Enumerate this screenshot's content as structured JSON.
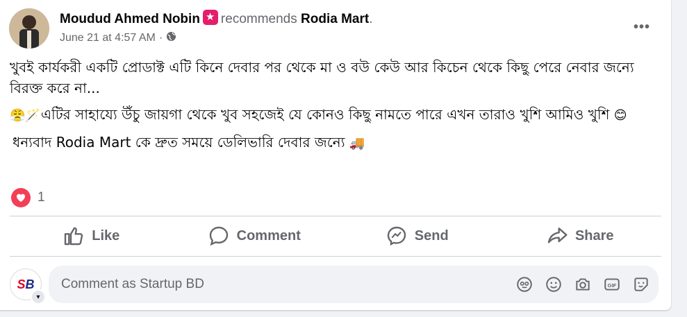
{
  "post": {
    "author": "Moudud Ahmed Nobin",
    "recommends_text": "recommends",
    "page_name": "Rodia Mart",
    "period": ".",
    "date": "June 21 at 4:57 AM",
    "separator": "·",
    "more": "•••",
    "line1": "খুবই কার্যকরী একটি প্রোডাক্ট এটি কিনে দেবার পর থেকে মা ও বউ কেউ আর কিচেন থেকে কিছু পেরে নেবার জন্যে বিরক্ত করে না...",
    "line2_emoji_a": "😤🪄",
    "line2": "এটির সাহায্যে উঁচু জায়গা থেকে খুব সহজেই যে কোনও কিছু নামতে পারে এখন তারাও খুশি আমিও খুশি",
    "line2_emoji_b": "😊",
    "line3": "ধন্যবাদ Rodia Mart কে দ্রুত সময়ে ডেলিভারি দেবার জন্যে",
    "line3_emoji": "🚚",
    "reaction_count": "1"
  },
  "actions": {
    "like": "Like",
    "comment": "Comment",
    "send": "Send",
    "share": "Share"
  },
  "comment_box": {
    "avatar_initials_s": "S",
    "avatar_initials_b": "B",
    "placeholder": "Comment as Startup BD"
  },
  "icons": [
    "globe-icon",
    "thumbs-up-icon",
    "comment-icon",
    "messenger-icon",
    "share-icon",
    "avatar-sticker-icon",
    "emoji-icon",
    "camera-icon",
    "gif-icon",
    "sticker-icon"
  ],
  "colors": {
    "heart": "#f33e58",
    "badge": "#e41e6b",
    "secondary_text": "#65676b"
  }
}
